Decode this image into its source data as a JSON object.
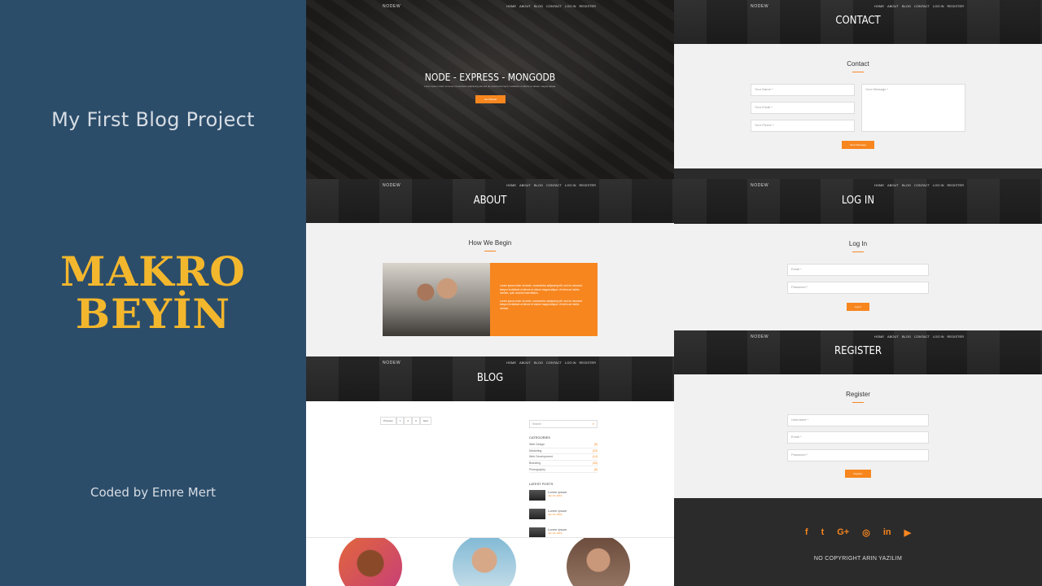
{
  "left_panel": {
    "title": "My First Blog Project",
    "brand_line1": "MAKRO",
    "brand_line2": "BEYİN",
    "credit": "Coded by Emre Mert"
  },
  "nav": {
    "logo": "NODEW",
    "links": [
      "HOME",
      "ABOUT",
      "BLOG",
      "CONTACT",
      "LOG IN",
      "REGISTER"
    ]
  },
  "home": {
    "hero_title": "NODE - EXPRESS - MONGODB",
    "hero_subtitle": "Lorem ipsum dolor sit amet consectetur adipiscing elit sed do eiusmod tempor incididunt ut labore et dolore magna aliqua.",
    "hero_button": "Get Started"
  },
  "contact_page": {
    "header": "CONTACT",
    "section_title": "Contact",
    "name_placeholder": "Your Name *",
    "email_placeholder": "Your Email *",
    "phone_placeholder": "Your Phone *",
    "message_placeholder": "Your Message *",
    "send_button": "Send Message"
  },
  "about_page": {
    "header": "ABOUT",
    "section_title": "How We Begin",
    "para1": "Lorem ipsum dolor sit amet, consectetur adipiscing elit, sed do eiusmod tempor incididunt ut labore et dolore magna aliqua. Ut enim ad minim veniam, quis nostrud exercitation.",
    "para2": "Lorem ipsum dolor sit amet, consectetur adipiscing elit, sed do eiusmod tempor incididunt ut labore et dolore magna aliqua. Ut enim ad minim veniam."
  },
  "login_page": {
    "header": "LOG IN",
    "section_title": "Log In",
    "email_placeholder": "Email *",
    "password_placeholder": "Password *",
    "login_button": "Log In"
  },
  "blog_page": {
    "header": "BLOG",
    "pager": [
      "Previous",
      "1",
      "2",
      "3",
      "Next"
    ],
    "search_placeholder": "Search",
    "categories_title": "CATEGORIES",
    "categories": [
      {
        "name": "Web Design",
        "count": "(5)"
      },
      {
        "name": "Marketing",
        "count": "(24)"
      },
      {
        "name": "Web Development",
        "count": "(14)"
      },
      {
        "name": "Branding",
        "count": "(40)"
      },
      {
        "name": "Photography",
        "count": "(6)"
      }
    ],
    "latest_title": "LATEST POSTS",
    "latest_posts": [
      {
        "title": "Lorem Ipsum",
        "date": "Jan 19, 2019"
      },
      {
        "title": "Lorem Ipsum",
        "date": "Jan 19, 2019"
      },
      {
        "title": "Lorem Ipsum",
        "date": "Jan 19, 2019"
      }
    ]
  },
  "register_page": {
    "header": "REGISTER",
    "section_title": "Register",
    "username_placeholder": "Username *",
    "email_placeholder": "Email *",
    "password_placeholder": "Password *",
    "register_button": "Register"
  },
  "footer": {
    "social_icons": [
      "facebook-icon",
      "twitter-icon",
      "google-plus-icon",
      "instagram-icon",
      "linkedin-icon",
      "youtube-icon"
    ],
    "social_glyphs": [
      "f",
      "t",
      "G+",
      "◎",
      "in",
      "▶"
    ],
    "copyright": "NO COPYRIGHT ARIN YAZILIM"
  },
  "colors": {
    "left_bg": "#2c4d6a",
    "brand": "#f3b72d",
    "accent": "#f7861f",
    "footer_bg": "#2b2b2b"
  }
}
